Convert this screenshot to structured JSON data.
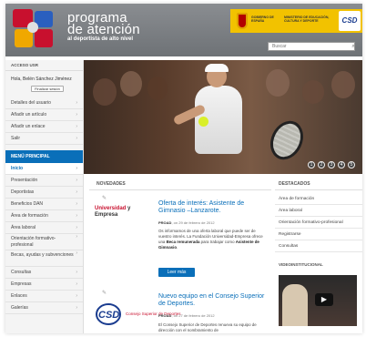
{
  "header": {
    "title_line1": "programa",
    "title_line2": "de atención",
    "subtitle": "al deportista de alto nivel",
    "gov1": "GOBIERNO DE ESPAÑA",
    "gov2": "MINISTERIO DE EDUCACIÓN, CULTURA Y DEPORTE",
    "csd_badge": "CSD",
    "search_placeholder": "Buscar"
  },
  "sidebar": {
    "access_title": "ACCESO USR",
    "greeting": "Hola, Belén Sánchez Jiménez",
    "logout": "Finalizar sesión",
    "user_items": [
      "Detalles del usuario",
      "Añadir un artículo",
      "Añadir un enlace",
      "Salir"
    ],
    "menu_title": "MENÚ PRINCIPAL",
    "menu_items": [
      "Inicio",
      "Presentación",
      "Deportistas",
      "Beneficios DAN",
      "Área de formación",
      "Área laboral",
      "Orientación formativo-profesional",
      "Becas, ayudas y subvenciones",
      "Consultas",
      "Empresas",
      "Enlaces",
      "Galerías"
    ]
  },
  "hero": {
    "dots": [
      "1",
      "2",
      "3",
      "4",
      "5"
    ]
  },
  "news": {
    "header": "NOVEDADES",
    "items": [
      {
        "logo_a": "Universidad",
        "logo_b": "y Empresa",
        "title": "Oferta de interés: Asistente de Gimnasio –Lanzarote.",
        "author": "PROAD",
        "date": ", on 29 de febrero de 2012",
        "body": "Os informamos de una oferta laboral que puede ser de vuestro interés. La Fundación Universidad-Empresa ofrece una",
        "body_b1": "Beca remunerada",
        "body_mid": "para trabajar como",
        "body_b2": "Asistente de Gimnasio",
        "body_end": ".",
        "more": "Leer más"
      },
      {
        "logo_csd": "CSD",
        "logo_caption": "Consejo Superior de Deportes",
        "title": "Nuevo equipo en el Consejo Superior de Deportes.",
        "author": "PROAD",
        "date": ", on 27 de febrero de 2012",
        "body": "El Consejo Superior de Deportes renueva su equipo de dirección con el nombramiento de"
      }
    ]
  },
  "highlights": {
    "header": "DESTACADOS",
    "items": [
      "Área de formación",
      "Área laboral",
      "Orientación formativo-profesional",
      "Registrarse",
      "Consultas"
    ],
    "video_header": "VIDEOINSTITUCIONAL"
  },
  "colors": {
    "accent": "#0a6fb9",
    "header_bg": "#7d8185",
    "gov_yellow": "#f2c200"
  }
}
